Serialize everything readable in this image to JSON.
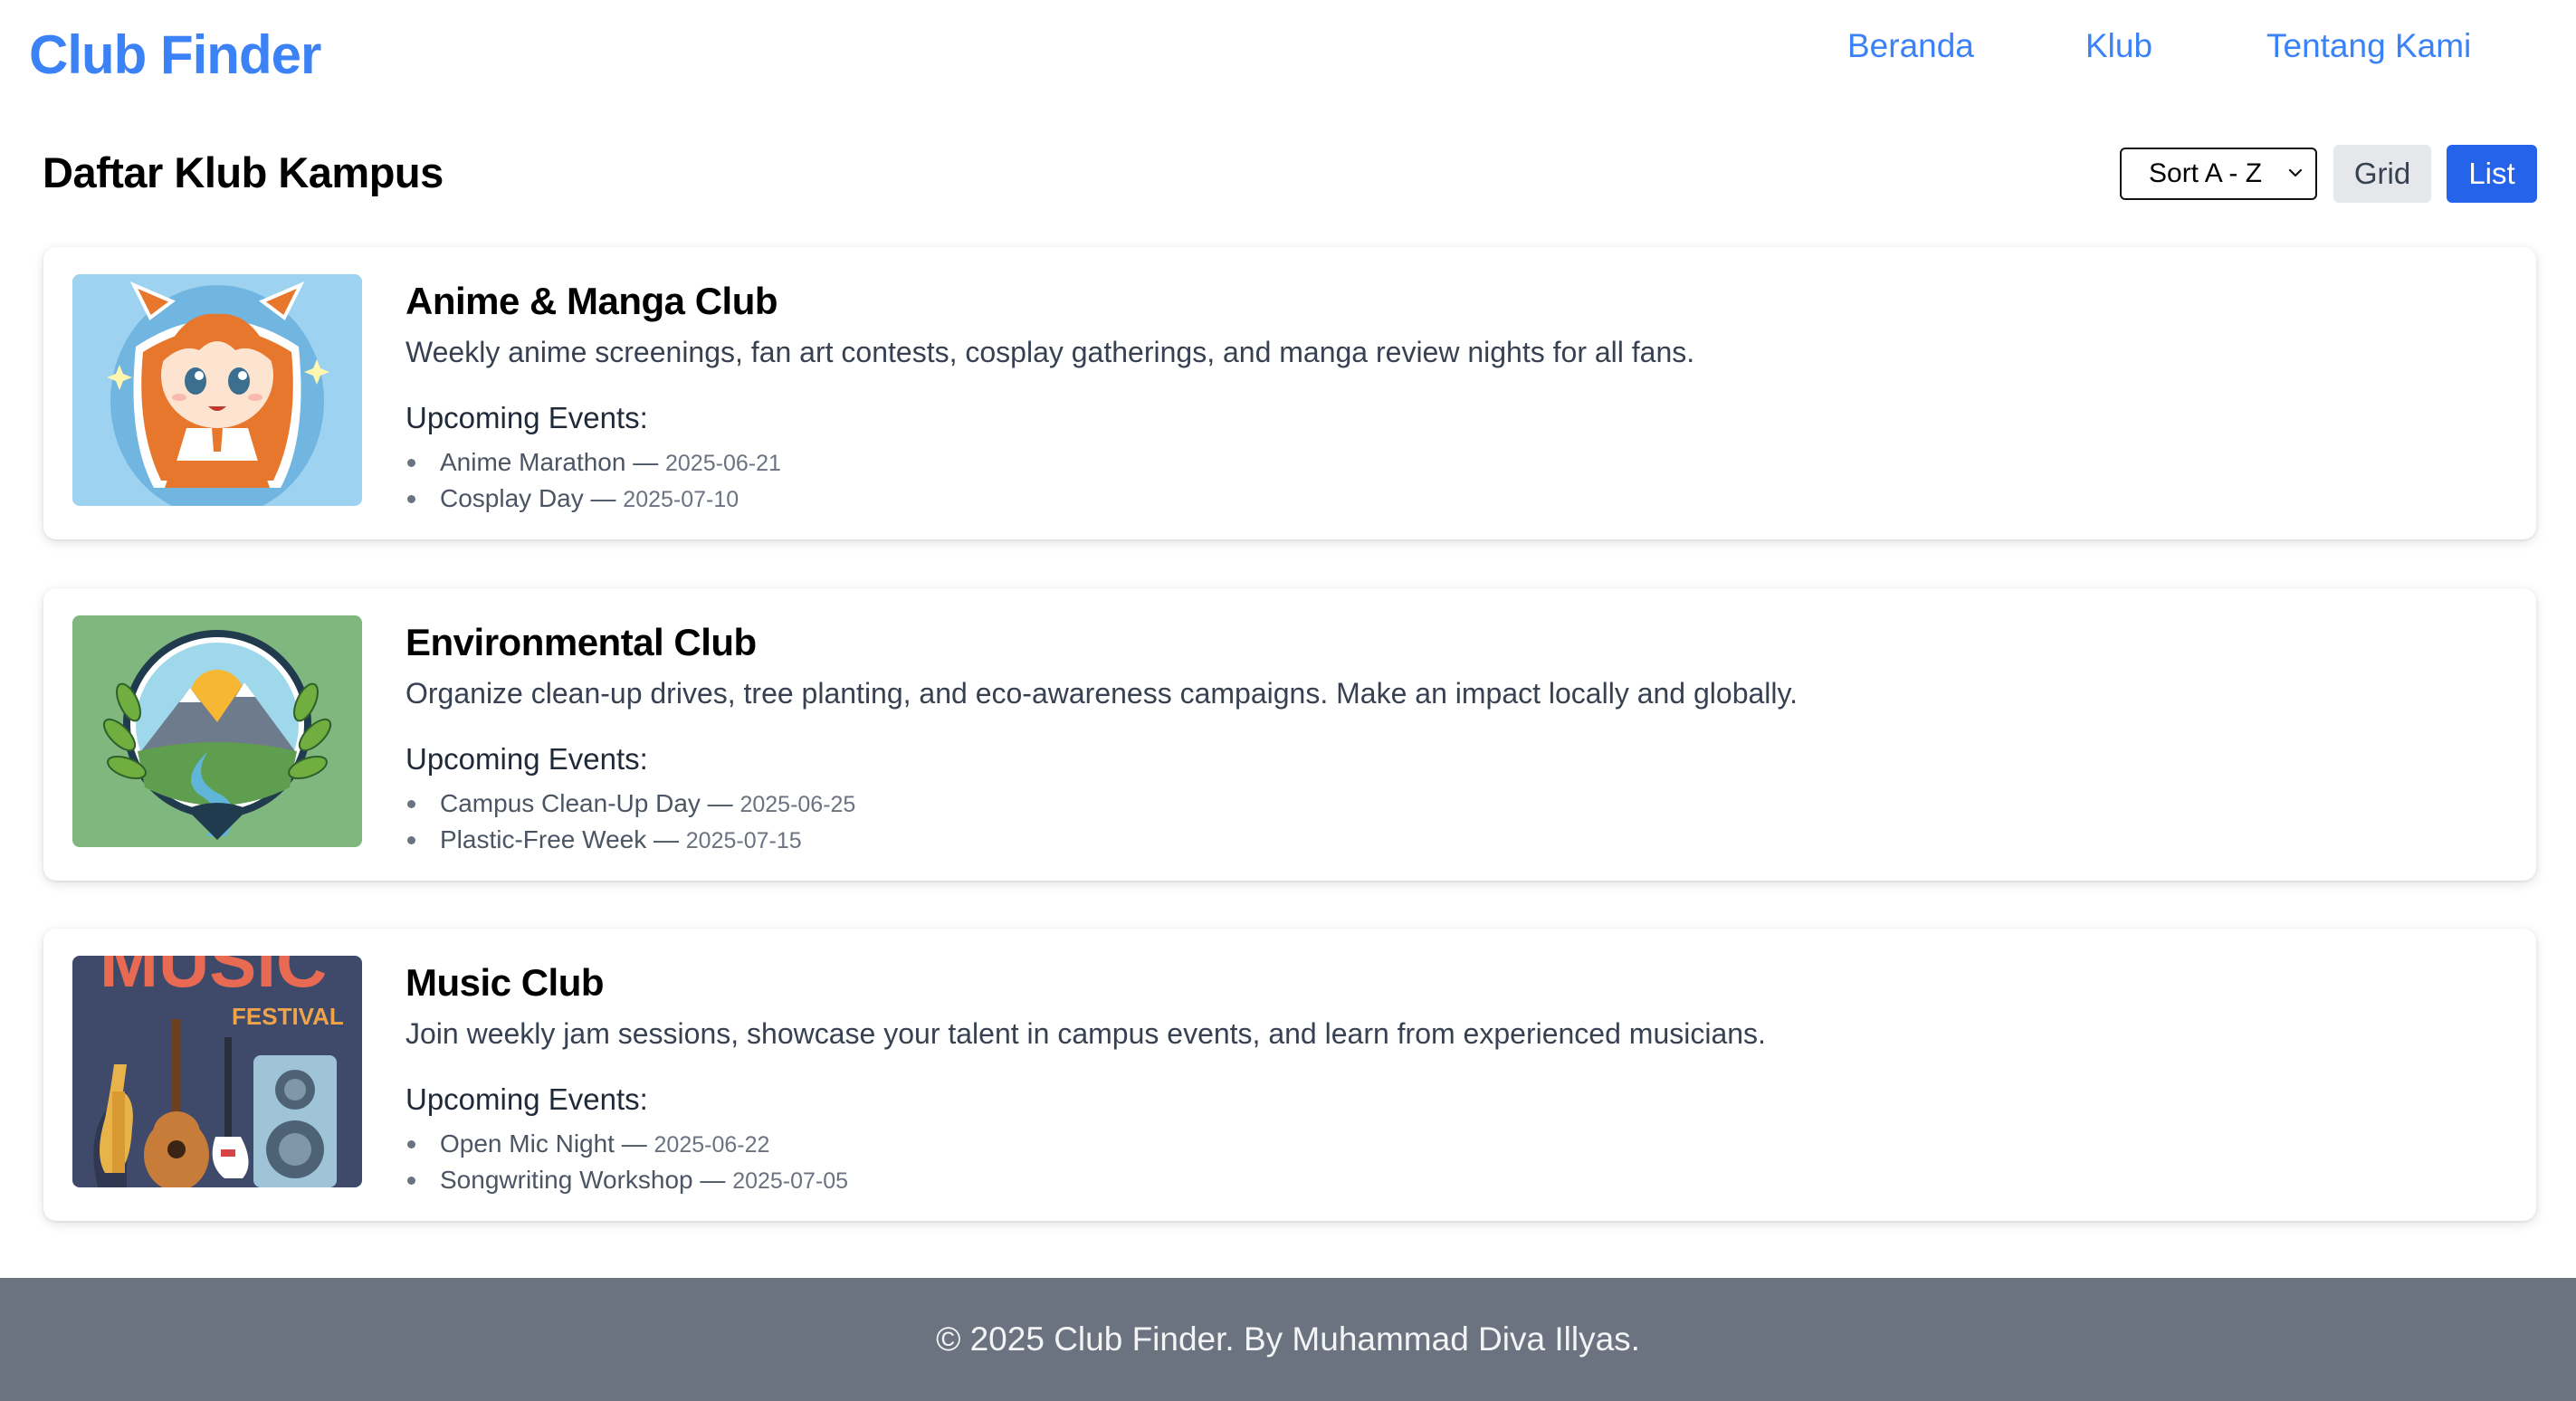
{
  "header": {
    "brand": "Club Finder",
    "nav": [
      {
        "label": "Beranda"
      },
      {
        "label": "Klub"
      },
      {
        "label": "Tentang Kami"
      }
    ]
  },
  "main": {
    "title": "Daftar Klub Kampus",
    "sort": {
      "selected": "Sort A - Z"
    },
    "view": {
      "grid_label": "Grid",
      "list_label": "List",
      "active": "List"
    },
    "events_heading": "Upcoming Events:",
    "clubs": [
      {
        "name": "Anime & Manga Club",
        "description": "Weekly anime screenings, fan art contests, cosplay gatherings, and manga review nights for all fans.",
        "image_icon": "anime-girl-illustration",
        "events": [
          {
            "name": "Anime Marathon",
            "date": "2025-06-21"
          },
          {
            "name": "Cosplay Day",
            "date": "2025-07-10"
          }
        ]
      },
      {
        "name": "Environmental Club",
        "description": "Organize clean-up drives, tree planting, and eco-awareness campaigns. Make an impact locally and globally.",
        "image_icon": "nature-emblem-illustration",
        "events": [
          {
            "name": "Campus Clean-Up Day",
            "date": "2025-06-25"
          },
          {
            "name": "Plastic-Free Week",
            "date": "2025-07-15"
          }
        ]
      },
      {
        "name": "Music Club",
        "description": "Join weekly jam sessions, showcase your talent in campus events, and learn from experienced musicians.",
        "image_icon": "music-festival-poster",
        "image_text": [
          "MUSIC",
          "FESTIVAL"
        ],
        "events": [
          {
            "name": "Open Mic Night",
            "date": "2025-06-22"
          },
          {
            "name": "Songwriting Workshop",
            "date": "2025-07-05"
          }
        ]
      }
    ]
  },
  "footer": {
    "text": "© 2025 Club Finder. By Muhammad Diva Illyas."
  },
  "colors": {
    "brand": "#3b82f6",
    "primary_button": "#2563eb",
    "secondary_button": "#e5e7eb",
    "footer_bg": "#6b7280"
  }
}
